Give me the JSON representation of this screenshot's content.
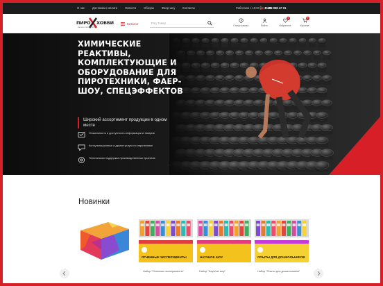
{
  "topbar": {
    "links": [
      "О нас",
      "Доставка и оплата",
      "Новости",
      "Обзоры",
      "Фаер-шоу",
      "Контакты"
    ],
    "hours": "Работаем с 10:00 до 20:00",
    "phone": "8 495 968 47 01"
  },
  "header": {
    "logo_left": "ПИРО",
    "logo_right": "ХОББИ",
    "logo_tagline": "магазин пиротехники",
    "catalog_label": "Каталог",
    "search_placeholder": "Ряд Товар",
    "icons": [
      {
        "label": "Статус заказа",
        "icon": "clock-icon"
      },
      {
        "label": "Войти",
        "icon": "user-icon"
      },
      {
        "label": "Избранное",
        "icon": "heart-icon",
        "badge": "0"
      },
      {
        "label": "Корзина",
        "icon": "cart-icon",
        "badge": "0"
      }
    ]
  },
  "hero": {
    "title": "ХИМИЧЕСКИЕ\nРЕАКТИВЫ,\nКОМПЛЕКТУЮЩИЕ И\nОБОРУДОВАНИЕ ДЛЯ\nПИРОТЕХНИКИ, ФАЕР-\nШОУ, СПЕЦЭФФЕКТОВ",
    "subtitle": "Широкий ассортимент продукции в одном месте",
    "features": [
      {
        "text": "Уникальность и доступность информации и товаров",
        "icon": "unique-icon"
      },
      {
        "text": "Консультационные и другие услуги по пиротехнике",
        "icon": "consult-icon"
      },
      {
        "text": "Техническая поддержка производственных проектов",
        "icon": "support-icon"
      }
    ],
    "accent": "#d61f26"
  },
  "news": {
    "title": "Новинки",
    "products": [
      {
        "name": ""
      },
      {
        "name": "Набор \"Огненные эксперименты\""
      },
      {
        "name": "Набор \"Научное шоу\""
      },
      {
        "name": "Набор \"Опыты для дошкольников\""
      }
    ],
    "box_labels": [
      {
        "title": "ОГНЕННЫЕ ЭКСПЕРИМЕНТЫ"
      },
      {
        "title": "НАУЧНОЕ ШОУ"
      },
      {
        "title": "ОПЫТЫ ДЛЯ ДОШКОЛЬНИКОВ"
      }
    ]
  }
}
